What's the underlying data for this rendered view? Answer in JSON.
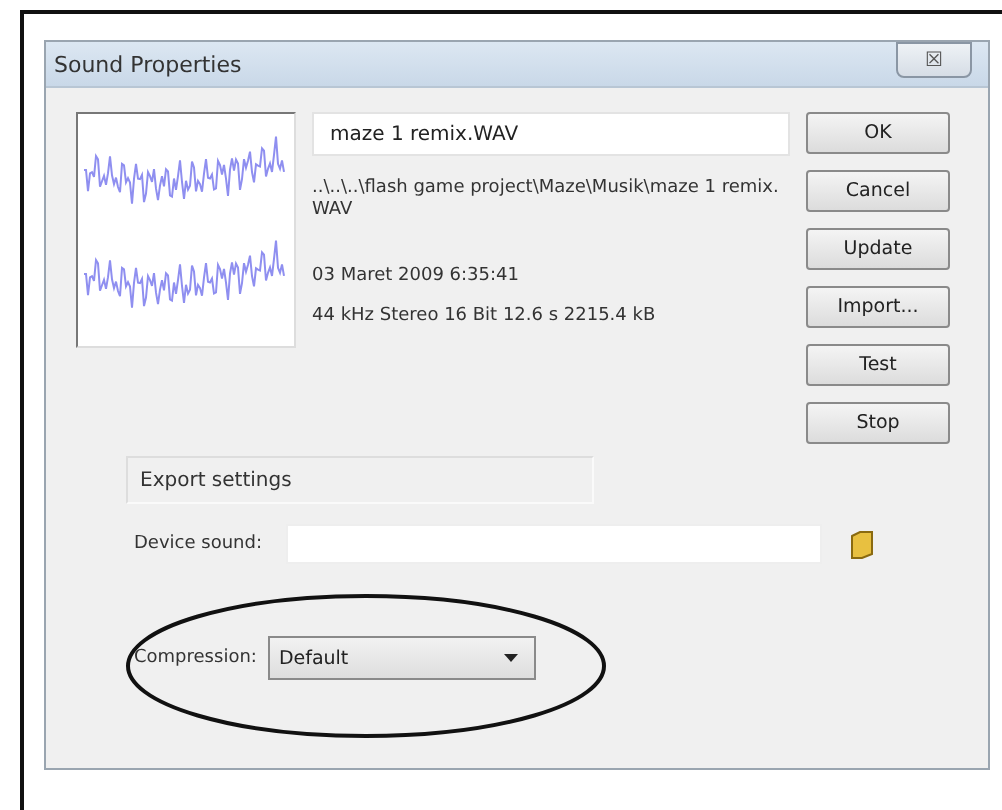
{
  "window": {
    "title": "Sound Properties",
    "close": "☒"
  },
  "sound": {
    "name": "maze 1 remix.WAV",
    "path": "..\\..\\..\\flash game project\\Maze\\Musik\\maze 1 remix.WAV",
    "date": "03 Maret 2009  6:35:41",
    "info": "44 kHz Stereo 16 Bit 12.6 s 2215.4 kB"
  },
  "buttons": [
    "OK",
    "Cancel",
    "Update",
    "Import...",
    "Test",
    "Stop"
  ],
  "export_settings": {
    "title": "Export settings",
    "device_sound": {
      "label": "Device sound:"
    },
    "compression": {
      "label": "Compression:",
      "value": "Default",
      "highlighted": true
    }
  }
}
